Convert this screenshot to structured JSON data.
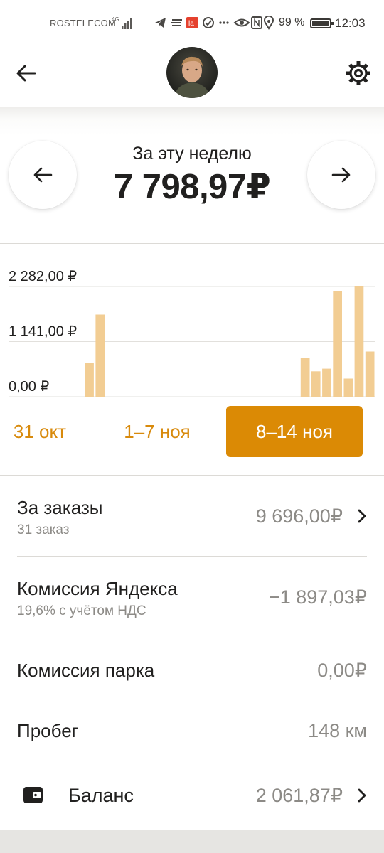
{
  "status_bar": {
    "carrier": "ROSTELECOM",
    "network": "4G",
    "battery": "99 %",
    "time": "12:03",
    "icons": [
      "telegram-icon",
      "menu-lines-icon",
      "notification-badge-icon",
      "check-circle-icon",
      "more-dots-icon",
      "eye-icon",
      "nfc-icon",
      "location-icon"
    ]
  },
  "header": {
    "back_icon": "arrow-left-icon",
    "avatar": "driver-avatar",
    "settings_icon": "gear-icon"
  },
  "summary": {
    "period_label": "За эту неделю",
    "total": "7 798,97₽",
    "prev_icon": "arrow-left-icon",
    "next_icon": "arrow-right-icon"
  },
  "chart_data": {
    "type": "bar",
    "ylim": [
      0,
      2282
    ],
    "y_ticks": [
      "2 282,00 ₽",
      "1 141,00 ₽",
      "0,00 ₽"
    ],
    "bar_color": "#f2cd93",
    "groups": [
      {
        "label": "31 окт",
        "values": [
          0,
          0,
          0,
          0,
          0,
          0,
          0
        ]
      },
      {
        "label": "1–7 ноя",
        "values": [
          0,
          0,
          0,
          0,
          0,
          0,
          0
        ]
      },
      {
        "label": "8–14 ноя",
        "values": [
          0,
          0,
          0,
          0,
          0,
          0,
          0
        ]
      }
    ],
    "bars": [
      {
        "value": 0
      },
      {
        "value": 0
      },
      {
        "value": 0
      },
      {
        "value": 0
      },
      {
        "value": 0
      },
      {
        "value": 0
      },
      {
        "value": 0
      },
      {
        "value": 693
      },
      {
        "value": 1700
      },
      {
        "value": 0
      },
      {
        "value": 0
      },
      {
        "value": 0
      },
      {
        "value": 0
      },
      {
        "value": 0
      },
      {
        "value": 0
      },
      {
        "value": 0
      },
      {
        "value": 0
      },
      {
        "value": 0
      },
      {
        "value": 0
      },
      {
        "value": 0
      },
      {
        "value": 0
      },
      {
        "value": 0
      },
      {
        "value": 0
      },
      {
        "value": 0
      },
      {
        "value": 0
      },
      {
        "value": 0
      },
      {
        "value": 0
      },
      {
        "value": 800
      },
      {
        "value": 525
      },
      {
        "value": 580
      },
      {
        "value": 2180
      },
      {
        "value": 375
      },
      {
        "value": 2282
      },
      {
        "value": 935
      }
    ],
    "selected_group": "8–14 ноя",
    "accent_color": "#db8a05"
  },
  "rows": [
    {
      "title": "За заказы",
      "subtitle": "31 заказ",
      "value": "9 696,00₽",
      "chevron": true
    },
    {
      "title": "Комиссия Яндекса",
      "subtitle": "19,6% с учётом НДС",
      "value": "−1 897,03₽",
      "chevron": false
    },
    {
      "title": "Комиссия парка",
      "subtitle": "",
      "value": "0,00₽",
      "chevron": false
    },
    {
      "title": "Пробег",
      "subtitle": "",
      "value": "148 км",
      "chevron": false
    }
  ],
  "balance": {
    "icon": "wallet-icon",
    "label": "Баланс",
    "value": "2 061,87₽"
  }
}
